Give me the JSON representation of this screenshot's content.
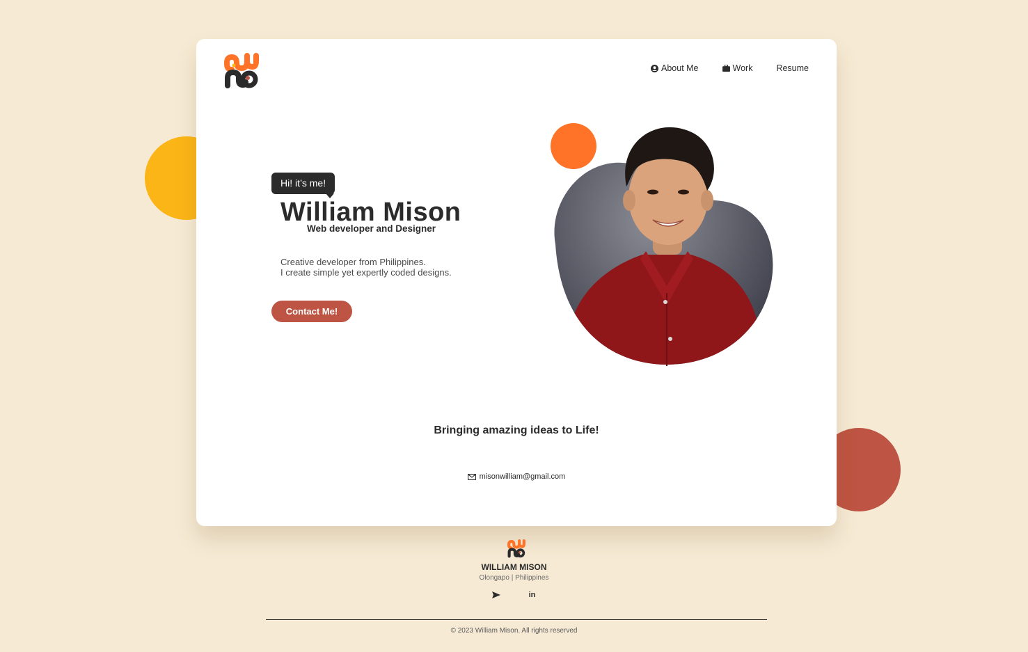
{
  "nav": {
    "items": [
      {
        "label": "About Me",
        "icon": "user-circle-icon"
      },
      {
        "label": "Work",
        "icon": "briefcase-icon"
      },
      {
        "label": "Resume",
        "icon": ""
      }
    ]
  },
  "hero": {
    "greeting": "Hi! it’s me!",
    "name": "William Mison",
    "role": "Web developer and Designer",
    "description_line1": "Creative developer from Philippines.",
    "description_line2": "I create simple yet expertly coded designs.",
    "cta_label": "Contact Me!",
    "photo_icon": "portrait-photo"
  },
  "tagline": "Bringing amazing ideas to Life!",
  "contact": {
    "email": "misonwilliam@gmail.com",
    "icon": "mail-icon"
  },
  "footer": {
    "name": "WILLIAM MISON",
    "location": "Olongapo | Philippines",
    "social": [
      {
        "icon": "send-icon"
      },
      {
        "icon": "linkedin-icon",
        "label": "in"
      }
    ],
    "copyright": "© 2023 William Mison. All rights reserved"
  },
  "colors": {
    "background": "#f6ead4",
    "card": "#ffffff",
    "accent_orange": "#fe7328",
    "accent_yellow": "#fbb516",
    "accent_red": "#be5443",
    "dark": "#2b2b2b"
  }
}
